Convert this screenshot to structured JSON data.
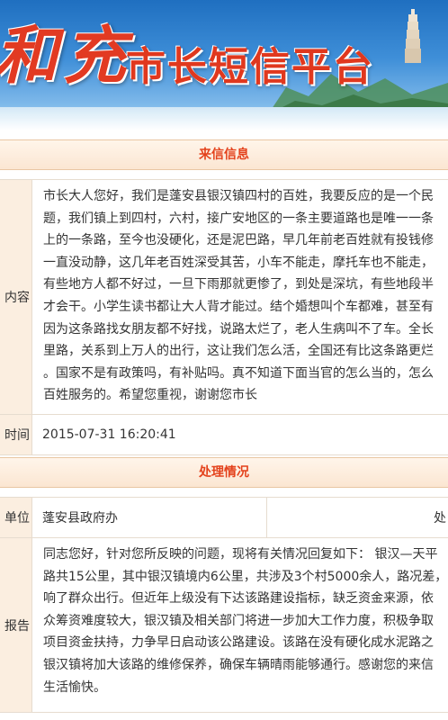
{
  "banner": {
    "city_name": "和充",
    "platform_title": "市长短信平台"
  },
  "letter_section": {
    "title": "来信信息",
    "content_label": "内容",
    "content_lines": [
      "市长大人您好，我们是蓬安县银汉镇四村的百姓，我要反应的是一个民",
      "题，我们镇上到四村，六村，接广安地区的一条主要道路也是唯一一条",
      "上的一条路，至今也没硬化，还是泥巴路，早几年前老百姓就有投钱修",
      "一直没动静，这几年老百姓深受其苦，小车不能走，摩托车也不能走，",
      "有些地方人都不好过，一旦下雨那就更惨了，到处是深坑，有些地段半",
      "才会干。小学生读书都让大人背才能过。结个婚想叫个车都难，甚至有",
      "因为这条路找女朋友都不好找，说路太烂了，老人生病叫不了车。全长",
      "里路，关系到上万人的出行，这让我们怎么活，全国还有比这条路更烂",
      "。国家不是有政策吗，有补贴吗。真不知道下面当官的怎么当的，怎么",
      "百姓服务的。希望您重视，谢谢您市长"
    ],
    "time_label": "时间",
    "time_value": "2015-07-31 16:20:41"
  },
  "handling_section": {
    "title": "处理情况",
    "unit_label": "单位",
    "unit_value": "蓬安县政府办",
    "unit_right": "处",
    "report_label": "报告",
    "report_lines": [
      "同志您好，针对您所反映的问题，现将有关情况回复如下： 银汉—天平",
      "路共15公里，其中银汉镇境内6公里，共涉及3个村5000余人，路况差，",
      "响了群众出行。但近年上级没有下达该路建设指标，缺乏资金来源，依",
      "众筹资难度较大，银汉镇及相关部门将进一步加大工作力度，积极争取",
      "项目资金扶持，力争早日启动该公路建设。该路在没有硬化成水泥路之",
      "银汉镇将加大该路的维修保养，确保车辆晴雨能够通行。感谢您的来信",
      "生活愉快。"
    ]
  },
  "colors": {
    "accent": "#e4421c",
    "label_bg": "#fbeee0",
    "header_bg": "#fbe6d2"
  }
}
